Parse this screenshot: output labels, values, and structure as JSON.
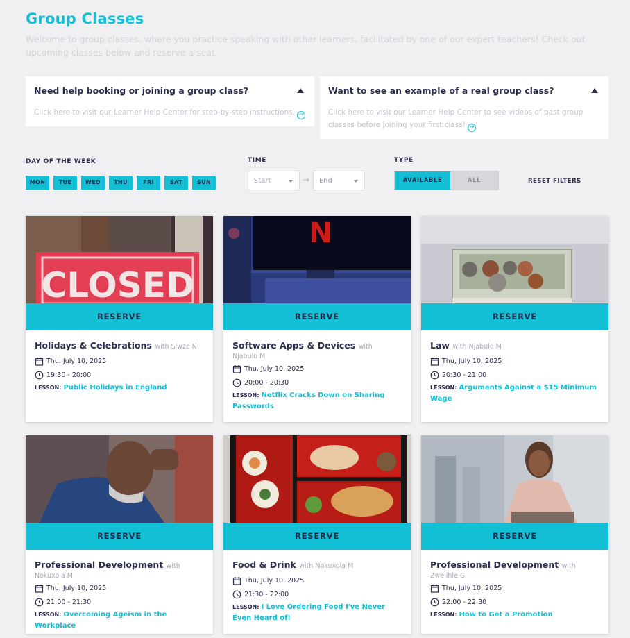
{
  "page": {
    "title": "Group Classes",
    "intro": "Welcome to group classes, where you practice speaking with other learners, facilitated by one of our expert teachers! Check out upcoming classes below and reserve a seat."
  },
  "help": [
    {
      "title": "Need help booking or joining a group class?",
      "body": "Click here to visit our Learner Help Center for step-by-step instructions."
    },
    {
      "title": "Want to see an example of a real group class?",
      "body": "Click here to visit our Learner Help Center to see videos of past group classes before joining your first class!"
    }
  ],
  "filters": {
    "day_label": "DAY OF THE WEEK",
    "days": [
      "MON",
      "TUE",
      "WED",
      "THU",
      "FRI",
      "SAT",
      "SUN"
    ],
    "time_label": "TIME",
    "start_placeholder": "Start",
    "end_placeholder": "End",
    "type_label": "TYPE",
    "type_available": "AVAILABLE",
    "type_all": "ALL",
    "reset": "RESET FILTERS"
  },
  "reserve_label": "RESERVE",
  "lesson_key": "LESSON:",
  "cards": [
    {
      "title": "Holidays & Celebrations",
      "with": "with Siwze N",
      "teacher": "",
      "date": "Thu, July 10, 2025",
      "time": "19:30 - 20:00",
      "lesson": "Public Holidays in England"
    },
    {
      "title": "Software Apps & Devices",
      "with": "with",
      "teacher": "Njabulo M",
      "date": "Thu, July 10, 2025",
      "time": "20:00 - 20:30",
      "lesson": "Netflix Cracks Down on Sharing Passwords"
    },
    {
      "title": "Law",
      "with": "with Njabulo M",
      "teacher": "",
      "date": "Thu, July 10, 2025",
      "time": "20:30 - 21:00",
      "lesson": "Arguments Against a $15 Minimum Wage"
    },
    {
      "title": "Professional Development",
      "with": "with",
      "teacher": "Nokuxola M",
      "date": "Thu, July 10, 2025",
      "time": "21:00 - 21:30",
      "lesson": "Overcoming Ageism in the Workplace"
    },
    {
      "title": "Food & Drink",
      "with": "with Nokuxola M",
      "teacher": "",
      "date": "Thu, July 10, 2025",
      "time": "21:30 - 22:00",
      "lesson": "I Love Ordering Food I've Never Even Heard of!"
    },
    {
      "title": "Professional Development",
      "with": "with",
      "teacher": "Zwelihle G.",
      "date": "Thu, July 10, 2025",
      "time": "22:00 - 22:30",
      "lesson": "How to Get a Promotion"
    }
  ],
  "image_text": {
    "closed_sign": "CLOSED",
    "tv_logo": "N"
  },
  "colors": {
    "accent": "#13bfd4",
    "text": "#2d2d4f",
    "background": "#f0f0f2"
  }
}
